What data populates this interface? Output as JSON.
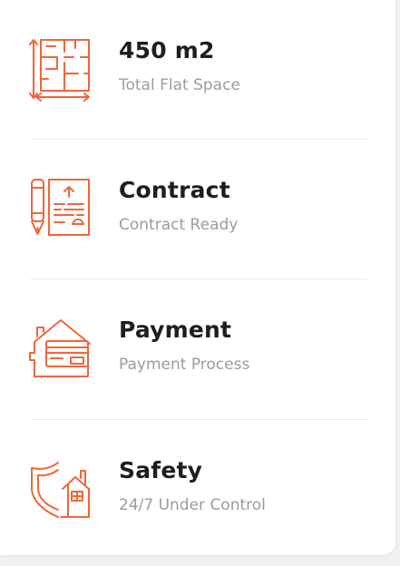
{
  "accent_color": "#f2653a",
  "features": [
    {
      "icon": "floor-plan-icon",
      "title": "450 m2",
      "subtitle": "Total Flat Space"
    },
    {
      "icon": "contract-icon",
      "title": "Contract",
      "subtitle": "Contract Ready"
    },
    {
      "icon": "payment-icon",
      "title": "Payment",
      "subtitle": "Payment Process"
    },
    {
      "icon": "safety-icon",
      "title": "Safety",
      "subtitle": "24/7 Under Control"
    }
  ]
}
